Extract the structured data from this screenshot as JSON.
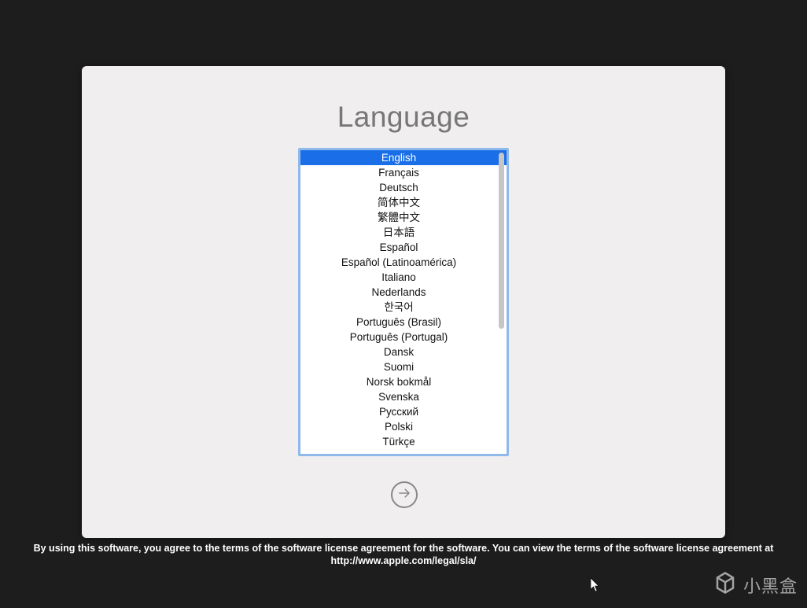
{
  "title": "Language",
  "selected_index": 0,
  "languages": [
    "English",
    "Français",
    "Deutsch",
    "简体中文",
    "繁體中文",
    "日本語",
    "Español",
    "Español (Latinoamérica)",
    "Italiano",
    "Nederlands",
    "한국어",
    "Português (Brasil)",
    "Português (Portugal)",
    "Dansk",
    "Suomi",
    "Norsk bokmål",
    "Svenska",
    "Русский",
    "Polski",
    "Türkçe"
  ],
  "legal_text": "By using this software, you agree to the terms of the software license agreement for the software. You can view the terms of the software license agreement at http://www.apple.com/legal/sla/",
  "watermark_text": "小黑盒"
}
